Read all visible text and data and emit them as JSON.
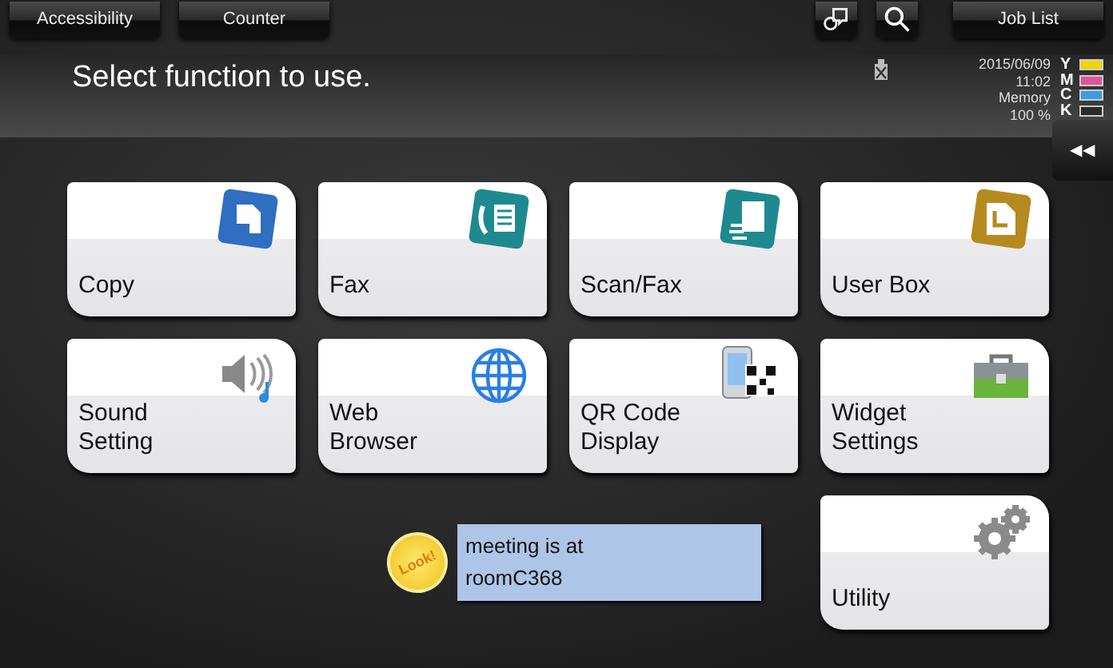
{
  "top_bar": {
    "left_buttons": [
      "Accessibility",
      "Counter"
    ],
    "right_button": "Job List"
  },
  "header": {
    "title": "Select function to use.",
    "date": "2015/06/09",
    "time": "11:02",
    "memory_label": "Memory",
    "memory_value": "100 %",
    "toners": [
      {
        "letter": "Y",
        "color": "#f2d400"
      },
      {
        "letter": "M",
        "color": "#e0559a"
      },
      {
        "letter": "C",
        "color": "#3a9ee0"
      },
      {
        "letter": "K",
        "color": "#2a2a2a"
      }
    ]
  },
  "side_tab": "◀◀",
  "tiles": [
    {
      "label": "Copy",
      "kind": "copy"
    },
    {
      "label": "Fax",
      "kind": "fax"
    },
    {
      "label": "Scan/Fax",
      "kind": "scan"
    },
    {
      "label": "User Box",
      "kind": "box"
    },
    {
      "label": "Sound Setting",
      "kind": "sound"
    },
    {
      "label": "Web Browser",
      "kind": "web"
    },
    {
      "label": "QR Code Display",
      "kind": "qr"
    },
    {
      "label": "Widget Settings",
      "kind": "widget"
    }
  ],
  "note": {
    "sticker": "Look!",
    "text": "meeting is at roomC368"
  },
  "utility_tile": {
    "label": "Utility",
    "kind": "utility"
  }
}
